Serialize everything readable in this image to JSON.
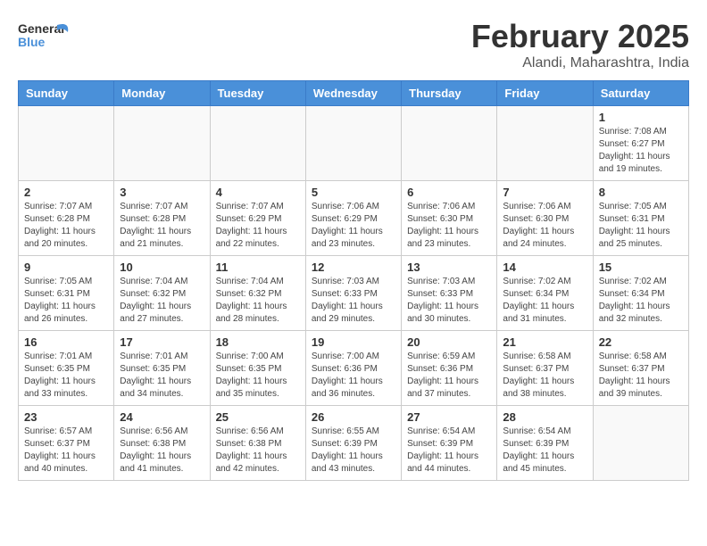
{
  "logo": {
    "general": "General",
    "blue": "Blue"
  },
  "title": "February 2025",
  "subtitle": "Alandi, Maharashtra, India",
  "days_of_week": [
    "Sunday",
    "Monday",
    "Tuesday",
    "Wednesday",
    "Thursday",
    "Friday",
    "Saturday"
  ],
  "weeks": [
    [
      {
        "day": "",
        "info": ""
      },
      {
        "day": "",
        "info": ""
      },
      {
        "day": "",
        "info": ""
      },
      {
        "day": "",
        "info": ""
      },
      {
        "day": "",
        "info": ""
      },
      {
        "day": "",
        "info": ""
      },
      {
        "day": "1",
        "info": "Sunrise: 7:08 AM\nSunset: 6:27 PM\nDaylight: 11 hours\nand 19 minutes."
      }
    ],
    [
      {
        "day": "2",
        "info": "Sunrise: 7:07 AM\nSunset: 6:28 PM\nDaylight: 11 hours\nand 20 minutes."
      },
      {
        "day": "3",
        "info": "Sunrise: 7:07 AM\nSunset: 6:28 PM\nDaylight: 11 hours\nand 21 minutes."
      },
      {
        "day": "4",
        "info": "Sunrise: 7:07 AM\nSunset: 6:29 PM\nDaylight: 11 hours\nand 22 minutes."
      },
      {
        "day": "5",
        "info": "Sunrise: 7:06 AM\nSunset: 6:29 PM\nDaylight: 11 hours\nand 23 minutes."
      },
      {
        "day": "6",
        "info": "Sunrise: 7:06 AM\nSunset: 6:30 PM\nDaylight: 11 hours\nand 23 minutes."
      },
      {
        "day": "7",
        "info": "Sunrise: 7:06 AM\nSunset: 6:30 PM\nDaylight: 11 hours\nand 24 minutes."
      },
      {
        "day": "8",
        "info": "Sunrise: 7:05 AM\nSunset: 6:31 PM\nDaylight: 11 hours\nand 25 minutes."
      }
    ],
    [
      {
        "day": "9",
        "info": "Sunrise: 7:05 AM\nSunset: 6:31 PM\nDaylight: 11 hours\nand 26 minutes."
      },
      {
        "day": "10",
        "info": "Sunrise: 7:04 AM\nSunset: 6:32 PM\nDaylight: 11 hours\nand 27 minutes."
      },
      {
        "day": "11",
        "info": "Sunrise: 7:04 AM\nSunset: 6:32 PM\nDaylight: 11 hours\nand 28 minutes."
      },
      {
        "day": "12",
        "info": "Sunrise: 7:03 AM\nSunset: 6:33 PM\nDaylight: 11 hours\nand 29 minutes."
      },
      {
        "day": "13",
        "info": "Sunrise: 7:03 AM\nSunset: 6:33 PM\nDaylight: 11 hours\nand 30 minutes."
      },
      {
        "day": "14",
        "info": "Sunrise: 7:02 AM\nSunset: 6:34 PM\nDaylight: 11 hours\nand 31 minutes."
      },
      {
        "day": "15",
        "info": "Sunrise: 7:02 AM\nSunset: 6:34 PM\nDaylight: 11 hours\nand 32 minutes."
      }
    ],
    [
      {
        "day": "16",
        "info": "Sunrise: 7:01 AM\nSunset: 6:35 PM\nDaylight: 11 hours\nand 33 minutes."
      },
      {
        "day": "17",
        "info": "Sunrise: 7:01 AM\nSunset: 6:35 PM\nDaylight: 11 hours\nand 34 minutes."
      },
      {
        "day": "18",
        "info": "Sunrise: 7:00 AM\nSunset: 6:35 PM\nDaylight: 11 hours\nand 35 minutes."
      },
      {
        "day": "19",
        "info": "Sunrise: 7:00 AM\nSunset: 6:36 PM\nDaylight: 11 hours\nand 36 minutes."
      },
      {
        "day": "20",
        "info": "Sunrise: 6:59 AM\nSunset: 6:36 PM\nDaylight: 11 hours\nand 37 minutes."
      },
      {
        "day": "21",
        "info": "Sunrise: 6:58 AM\nSunset: 6:37 PM\nDaylight: 11 hours\nand 38 minutes."
      },
      {
        "day": "22",
        "info": "Sunrise: 6:58 AM\nSunset: 6:37 PM\nDaylight: 11 hours\nand 39 minutes."
      }
    ],
    [
      {
        "day": "23",
        "info": "Sunrise: 6:57 AM\nSunset: 6:37 PM\nDaylight: 11 hours\nand 40 minutes."
      },
      {
        "day": "24",
        "info": "Sunrise: 6:56 AM\nSunset: 6:38 PM\nDaylight: 11 hours\nand 41 minutes."
      },
      {
        "day": "25",
        "info": "Sunrise: 6:56 AM\nSunset: 6:38 PM\nDaylight: 11 hours\nand 42 minutes."
      },
      {
        "day": "26",
        "info": "Sunrise: 6:55 AM\nSunset: 6:39 PM\nDaylight: 11 hours\nand 43 minutes."
      },
      {
        "day": "27",
        "info": "Sunrise: 6:54 AM\nSunset: 6:39 PM\nDaylight: 11 hours\nand 44 minutes."
      },
      {
        "day": "28",
        "info": "Sunrise: 6:54 AM\nSunset: 6:39 PM\nDaylight: 11 hours\nand 45 minutes."
      },
      {
        "day": "",
        "info": ""
      }
    ]
  ]
}
